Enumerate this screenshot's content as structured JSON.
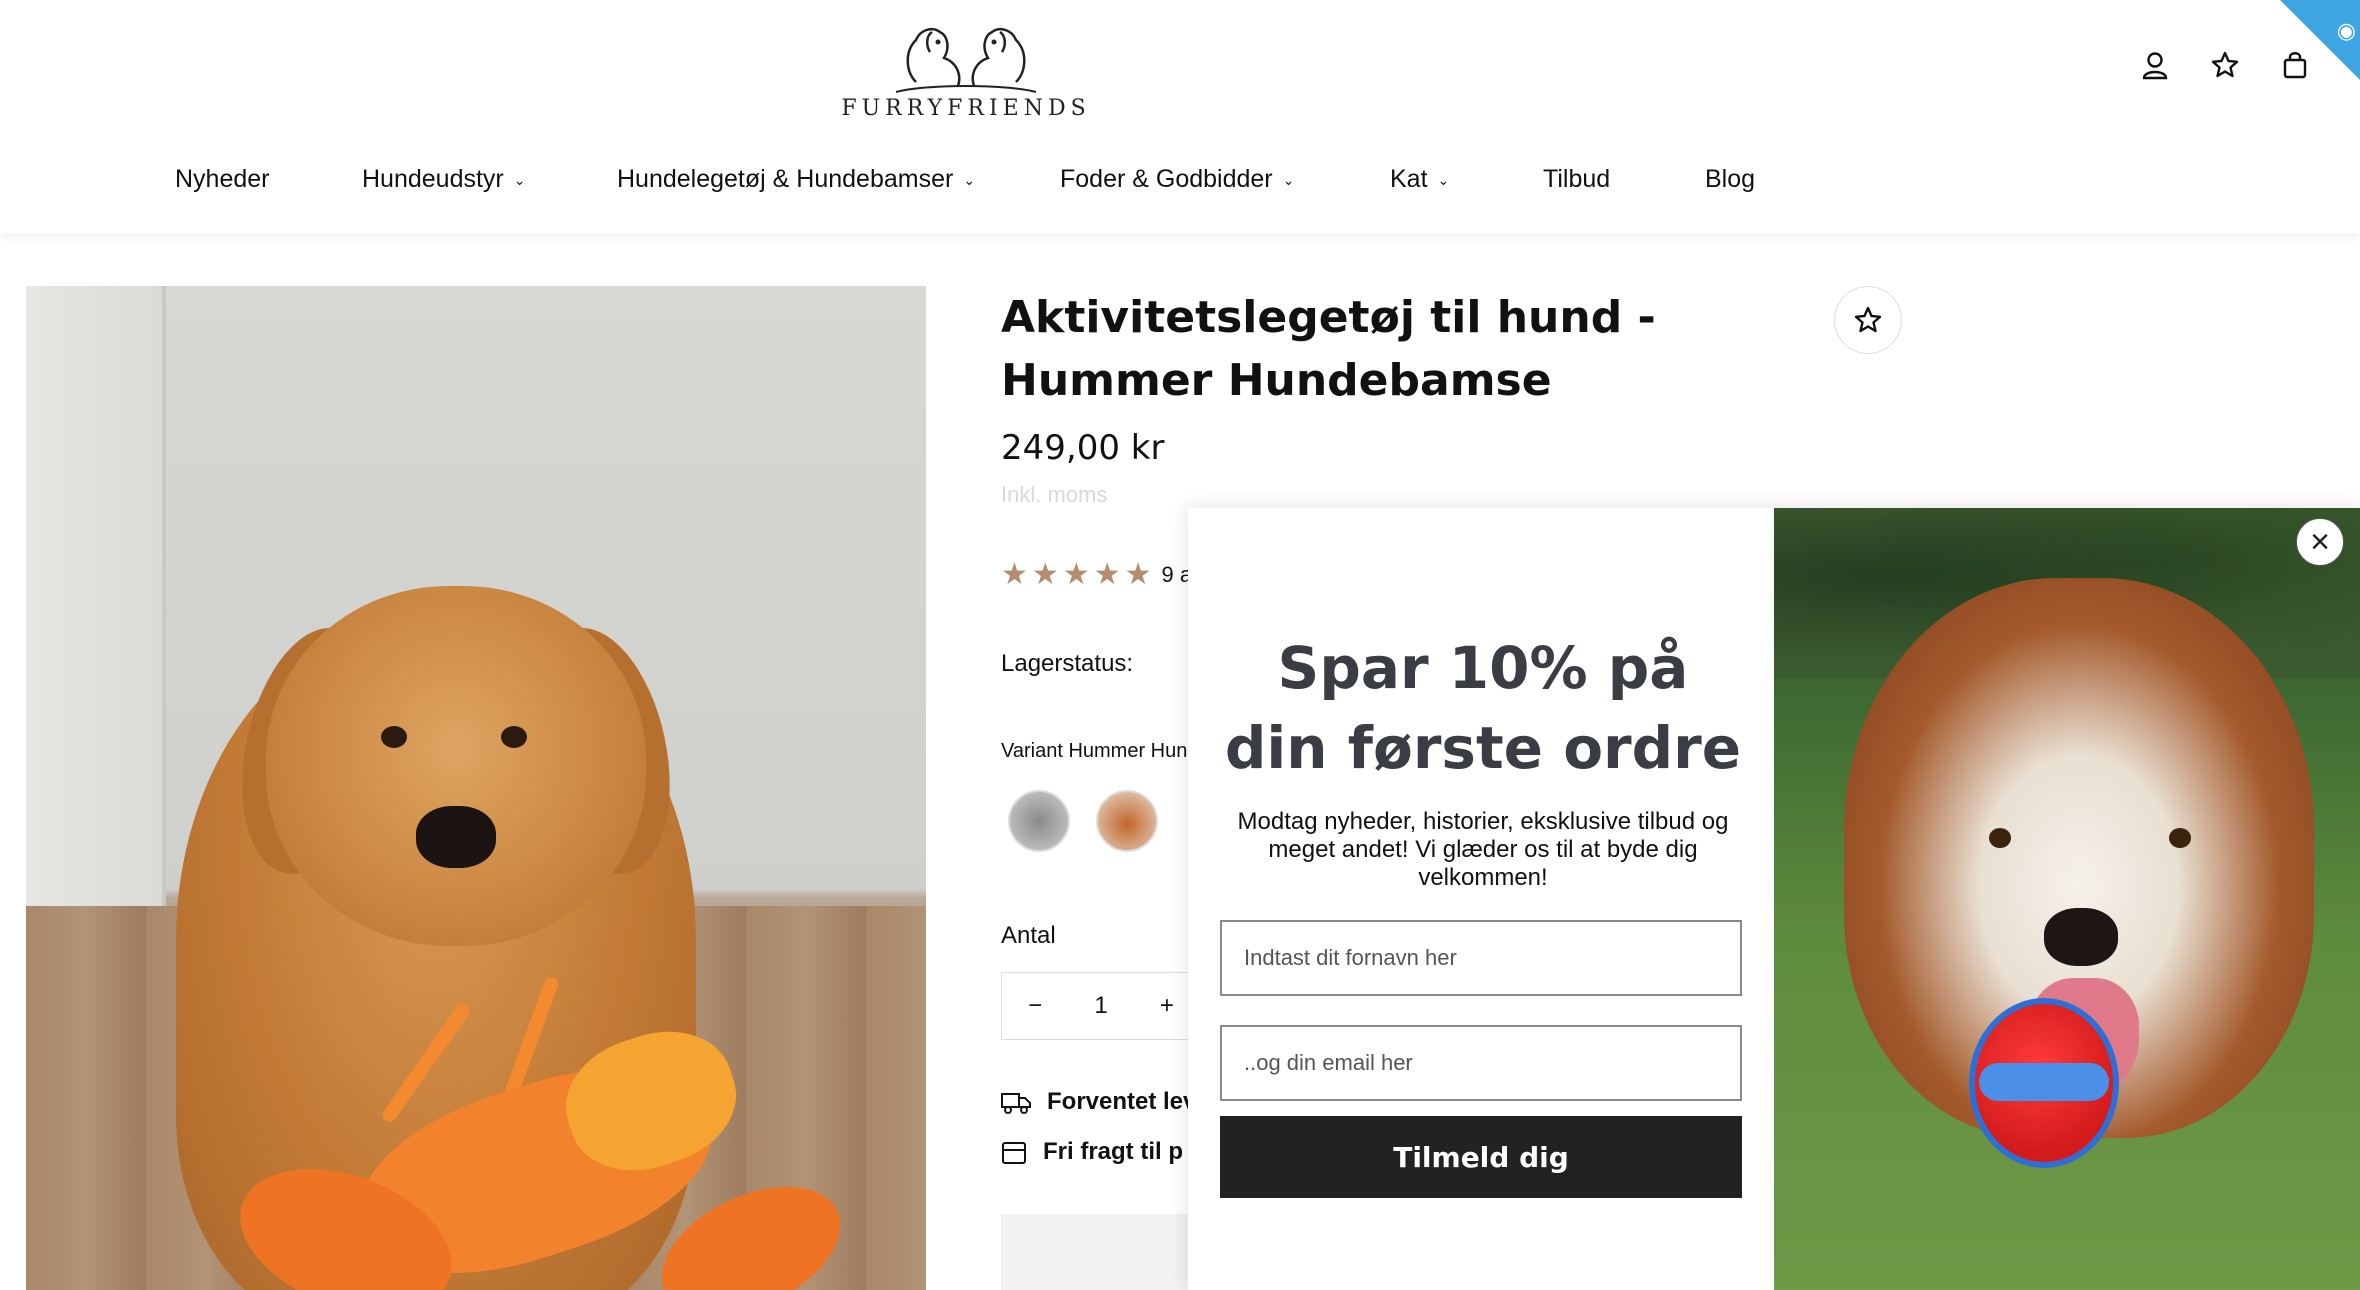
{
  "header": {
    "logo_text": "FURRYFRIENDS",
    "icons": [
      "user-icon",
      "star-icon",
      "bag-icon"
    ]
  },
  "nav": {
    "items": [
      {
        "label": "Nyheder",
        "has_dropdown": false
      },
      {
        "label": "Hundeudstyr",
        "has_dropdown": true
      },
      {
        "label": "Hundelegetøj & Hundebamser",
        "has_dropdown": true
      },
      {
        "label": "Foder & Godbidder",
        "has_dropdown": true
      },
      {
        "label": "Kat",
        "has_dropdown": true
      },
      {
        "label": "Tilbud",
        "has_dropdown": false
      },
      {
        "label": "Blog",
        "has_dropdown": false
      }
    ]
  },
  "product": {
    "title": "Aktivitetslegetøj til hund - Hummer Hundebamse",
    "price": "249,00 kr",
    "vat_note": "Inkl. moms",
    "rating": 5,
    "reviews_text": "9 an",
    "stock_label": "Lagerstatus:",
    "variant_label": "Variant Hummer Hun",
    "quantity_label": "Antal",
    "quantity_value": "1",
    "minus": "−",
    "plus": "+",
    "shipping_expected": "Forventet lev",
    "free_shipping": "Fri fragt til p"
  },
  "popup": {
    "title": "Spar 10% på din første ordre",
    "text": "Modtag nyheder, historier, eksklusive tilbud og meget andet! Vi glæder os til at byde dig velkommen!",
    "firstname_placeholder": "Indtast dit fornavn her",
    "email_placeholder": "..og din email her",
    "submit_label": "Tilmeld dig",
    "close_label": "×"
  },
  "colors": {
    "accent_star": "#b48c6e",
    "button_dark": "#222222",
    "corner_badge": "#3fa6e4"
  }
}
